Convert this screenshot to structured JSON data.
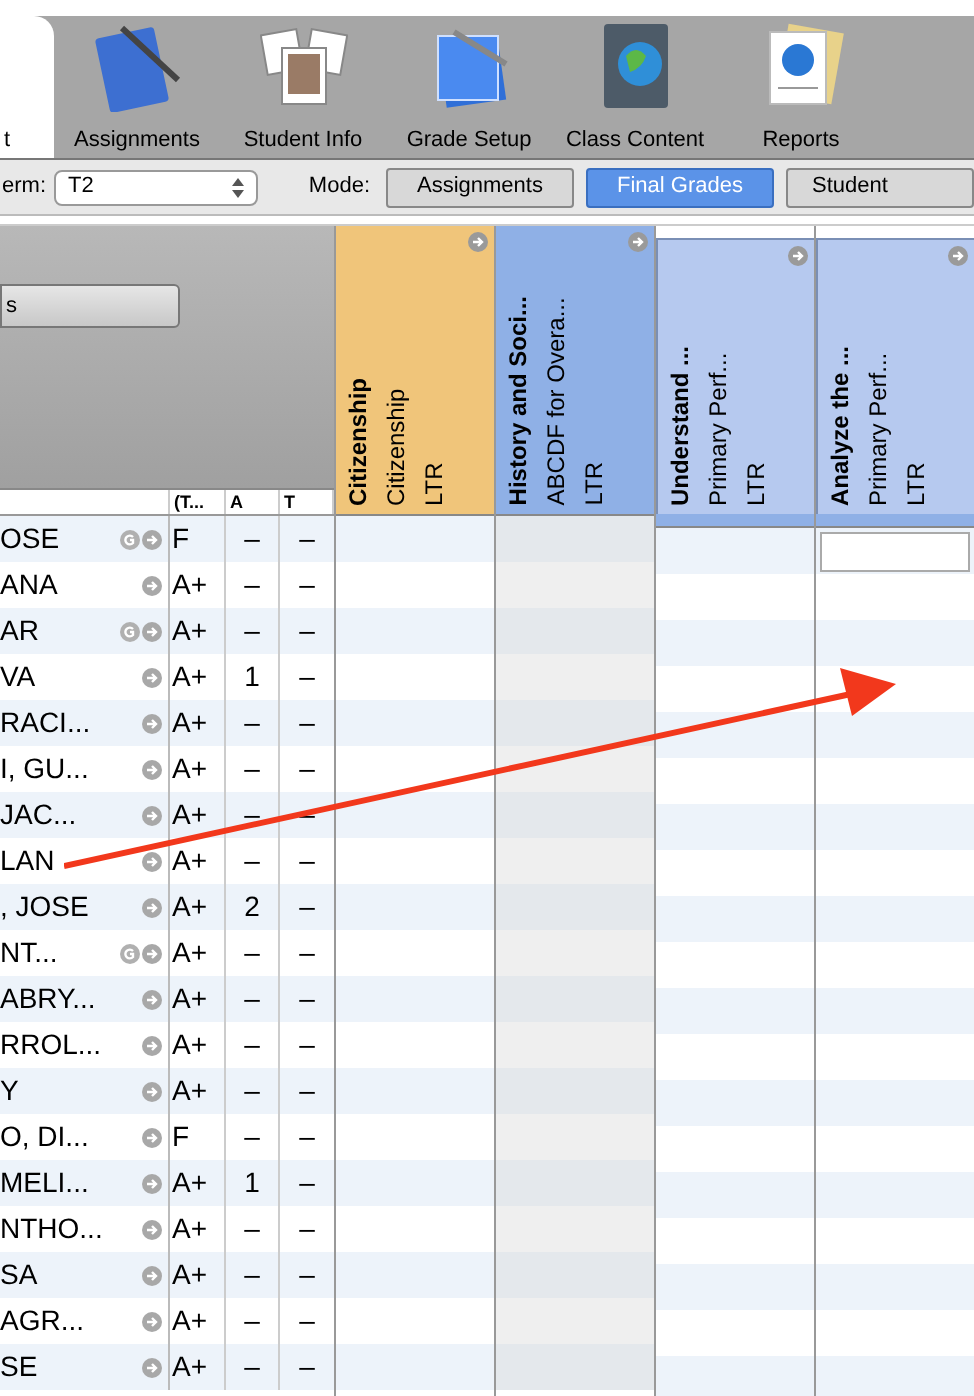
{
  "toolbar": {
    "tabs": [
      {
        "label": "t",
        "selected": true
      },
      {
        "label": "Assignments",
        "selected": false
      },
      {
        "label": "Student Info",
        "selected": false
      },
      {
        "label": "Grade Setup",
        "selected": false
      },
      {
        "label": "Class Content",
        "selected": false
      },
      {
        "label": "Reports",
        "selected": false
      }
    ]
  },
  "term": {
    "label": "erm:",
    "value": "T2"
  },
  "mode": {
    "label": "Mode:",
    "buttons": [
      {
        "label": "Assignments",
        "selected": false
      },
      {
        "label": "Final Grades",
        "selected": true
      },
      {
        "label": "Student",
        "selected": false
      }
    ]
  },
  "left_panel": {
    "button": "s",
    "columns": [
      "(T...",
      "A",
      "T"
    ],
    "rows": [
      {
        "name": "OSE",
        "flagged": true,
        "grade": "F",
        "a": "–",
        "t": "–"
      },
      {
        "name": "ANA",
        "flagged": false,
        "grade": "A+",
        "a": "–",
        "t": "–"
      },
      {
        "name": "AR",
        "flagged": true,
        "grade": "A+",
        "a": "–",
        "t": "–"
      },
      {
        "name": "VA",
        "flagged": false,
        "grade": "A+",
        "a": "1",
        "t": "–"
      },
      {
        "name": "RACI...",
        "flagged": false,
        "grade": "A+",
        "a": "–",
        "t": "–"
      },
      {
        "name": "I, GU...",
        "flagged": false,
        "grade": "A+",
        "a": "–",
        "t": "–"
      },
      {
        "name": "JAC...",
        "flagged": false,
        "grade": "A+",
        "a": "–",
        "t": "–"
      },
      {
        "name": "LAN",
        "flagged": false,
        "grade": "A+",
        "a": "–",
        "t": "–"
      },
      {
        "name": ", JOSE",
        "flagged": false,
        "grade": "A+",
        "a": "2",
        "t": "–"
      },
      {
        "name": "NT...",
        "flagged": true,
        "grade": "A+",
        "a": "–",
        "t": "–"
      },
      {
        "name": "ABRY...",
        "flagged": false,
        "grade": "A+",
        "a": "–",
        "t": "–"
      },
      {
        "name": "RROL...",
        "flagged": false,
        "grade": "A+",
        "a": "–",
        "t": "–"
      },
      {
        "name": "Y",
        "flagged": false,
        "grade": "A+",
        "a": "–",
        "t": "–"
      },
      {
        "name": "O, DI...",
        "flagged": false,
        "grade": "F",
        "a": "–",
        "t": "–"
      },
      {
        "name": "MELI...",
        "flagged": false,
        "grade": "A+",
        "a": "1",
        "t": "–"
      },
      {
        "name": "NTHO...",
        "flagged": false,
        "grade": "A+",
        "a": "–",
        "t": "–"
      },
      {
        "name": "SA",
        "flagged": false,
        "grade": "A+",
        "a": "–",
        "t": "–"
      },
      {
        "name": "AGR...",
        "flagged": false,
        "grade": "A+",
        "a": "–",
        "t": "–"
      },
      {
        "name": "SE",
        "flagged": false,
        "grade": "A+",
        "a": "–",
        "t": "–"
      }
    ]
  },
  "grade_columns": [
    {
      "kind": "category",
      "title": "Citizenship",
      "subtitle": "Citizenship",
      "type": "LTR",
      "color": "#f0c57a",
      "editing": false
    },
    {
      "kind": "category",
      "title": "History and Soci...",
      "subtitle": "ABCDF for Overa...",
      "type": "LTR",
      "color": "#8fb0e6",
      "editing": false
    },
    {
      "kind": "standard",
      "title": "Understand ...",
      "subtitle": "Primary Perf...",
      "type": "LTR",
      "color": "#b6c9ef",
      "editing": false
    },
    {
      "kind": "standard",
      "title": "Analyze the ...",
      "subtitle": "Primary Perf...",
      "type": "LTR",
      "color": "#b6c9ef",
      "editing": true
    }
  ]
}
